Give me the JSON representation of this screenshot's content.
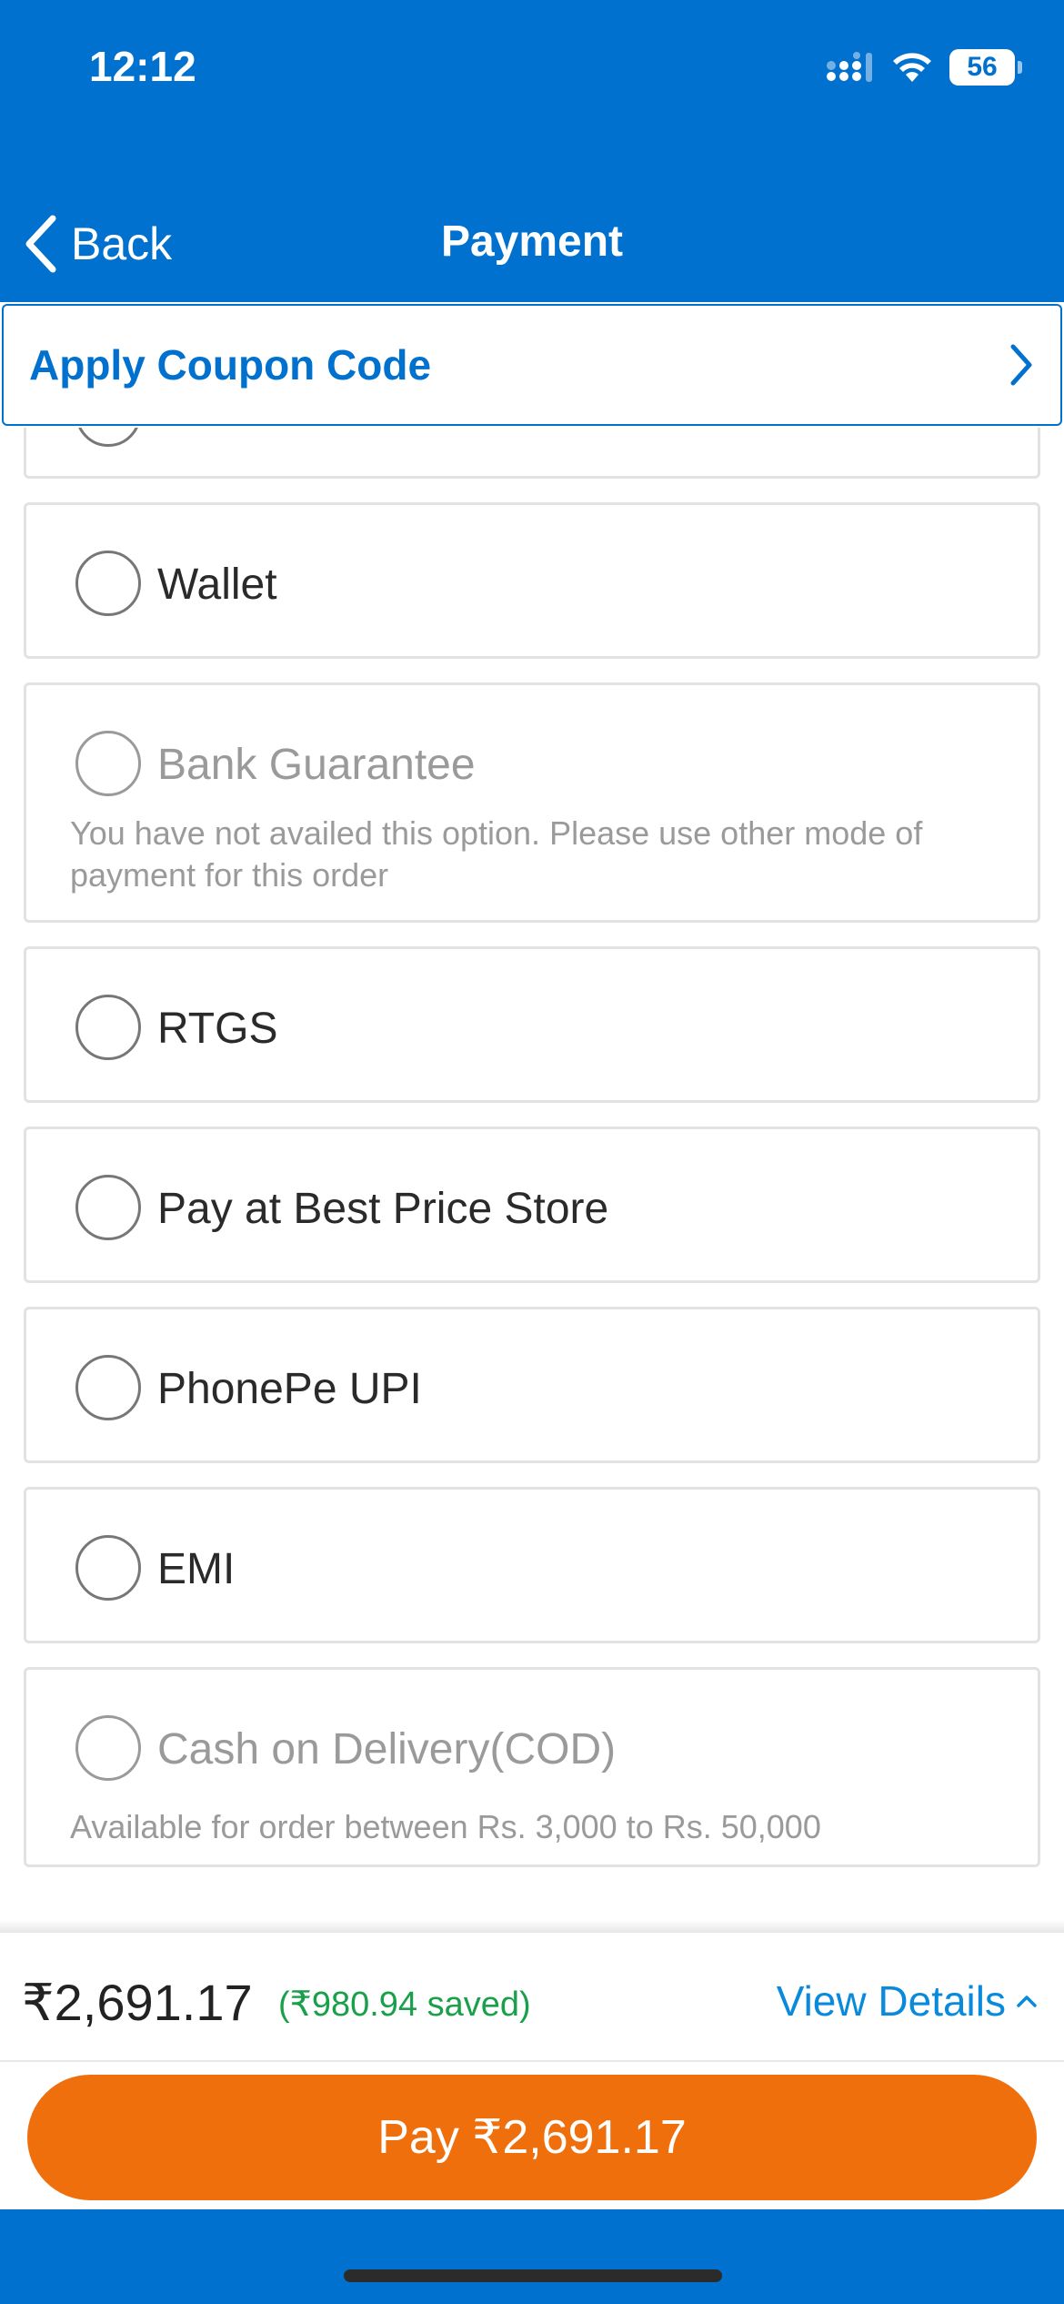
{
  "status_bar": {
    "time": "12:12",
    "battery": "56",
    "icons": [
      "signal-icon",
      "wifi-icon",
      "battery-icon"
    ]
  },
  "nav": {
    "back_label": "Back",
    "title": "Payment"
  },
  "coupon": {
    "label": "Apply Coupon Code"
  },
  "payment_methods": [
    {
      "label": "Wallet",
      "note": "",
      "disabled": false
    },
    {
      "label": "Bank Guarantee",
      "note": "You have not availed this option. Please use other mode of payment for this order",
      "disabled": true
    },
    {
      "label": "RTGS",
      "note": "",
      "disabled": false
    },
    {
      "label": "Pay at Best Price Store",
      "note": "",
      "disabled": false
    },
    {
      "label": "PhonePe UPI",
      "note": "",
      "disabled": false
    },
    {
      "label": "EMI",
      "note": "",
      "disabled": false
    },
    {
      "label": "Cash on Delivery(COD)",
      "note": "Available for order between Rs. 3,000 to Rs. 50,000",
      "disabled": true
    }
  ],
  "summary": {
    "total": "₹2,691.17",
    "saved": "(₹980.94 saved)",
    "view_details": "View Details"
  },
  "pay_button": {
    "label": "Pay ₹2,691.17"
  },
  "colors": {
    "brand_blue": "#0071ce",
    "pay_orange": "#ef6f0d",
    "saved_green": "#1aa04a",
    "link_blue": "#0a8adc"
  }
}
